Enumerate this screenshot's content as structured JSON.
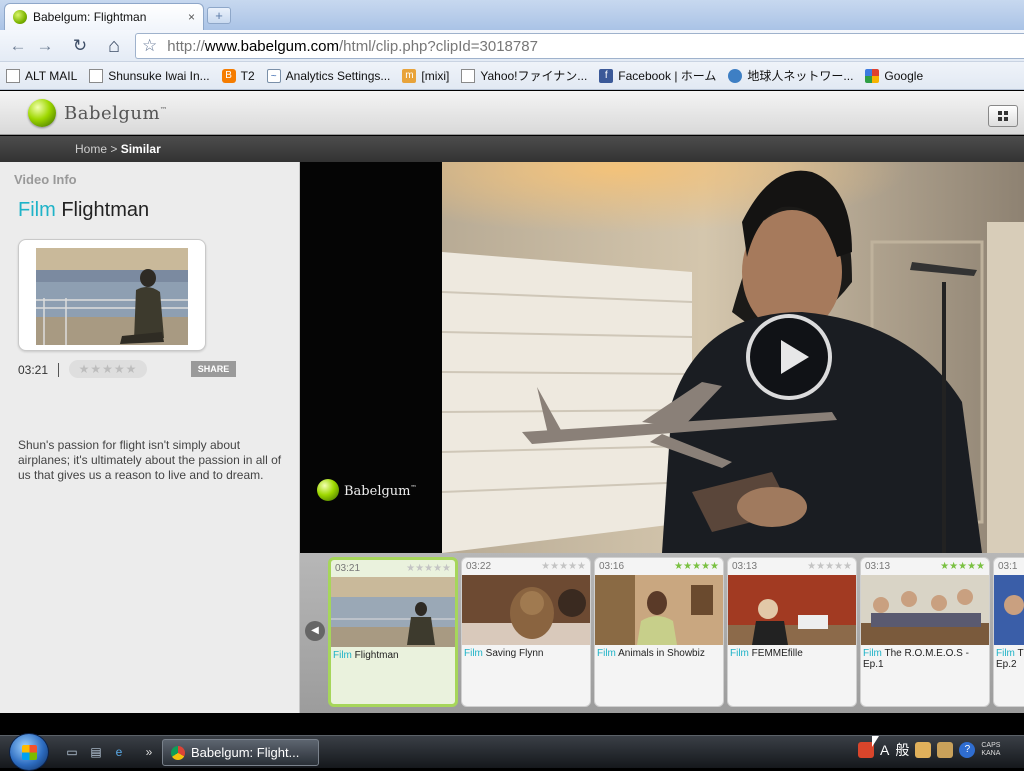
{
  "browser": {
    "tab_title": "Babelgum: Flightman",
    "close_glyph": "×",
    "new_tab_glyph": "+",
    "url_scheme": "http://",
    "url_host": "www.babelgum.com",
    "url_path": "/html/clip.php?clipId=3018787",
    "back_glyph": "←",
    "forward_glyph": "→",
    "reload_glyph": "↻",
    "home_glyph": "⌂",
    "star_glyph": "☆"
  },
  "bookmarks": [
    {
      "label": "ALT MAIL",
      "icon": "page-icon"
    },
    {
      "label": "Shunsuke Iwai In...",
      "icon": "page-icon"
    },
    {
      "label": "T2",
      "icon": "blogger-icon"
    },
    {
      "label": "Analytics Settings...",
      "icon": "analytics-icon"
    },
    {
      "label": "[mixi]",
      "icon": "mixi-icon"
    },
    {
      "label": "Yahoo!ファイナン...",
      "icon": "page-icon"
    },
    {
      "label": "Facebook | ホーム",
      "icon": "facebook-icon"
    },
    {
      "label": "地球人ネットワー...",
      "icon": "earth-icon"
    },
    {
      "label": "Google",
      "icon": "google-icon"
    }
  ],
  "site": {
    "logo_text": "Babelgum",
    "logo_tm": "™",
    "breadcrumb_home": "Home",
    "breadcrumb_sep": ">",
    "breadcrumb_current": "Similar"
  },
  "info": {
    "section_label": "Video Info",
    "category": "Film",
    "title": "Flightman",
    "duration": "03:21",
    "stars": "★★★★★",
    "share_label": "SHARE",
    "description": "Shun's passion for flight isn't simply about airplanes; it's ultimately about the passion in all of us that gives us a reason to live and to dream."
  },
  "player": {
    "logo_text": "Babelgum",
    "logo_tm": "™"
  },
  "related": [
    {
      "duration": "03:21",
      "stars": "★★★★★",
      "rated": false,
      "category": "Film",
      "title": "Flightman",
      "selected": true
    },
    {
      "duration": "03:22",
      "stars": "★★★★★",
      "rated": false,
      "category": "Film",
      "title": "Saving Flynn",
      "selected": false
    },
    {
      "duration": "03:16",
      "stars": "★★★★★",
      "rated": true,
      "category": "Film",
      "title": "Animals in Showbiz",
      "selected": false
    },
    {
      "duration": "03:13",
      "stars": "★★★★★",
      "rated": false,
      "category": "Film",
      "title": "FEMMEfille",
      "selected": false
    },
    {
      "duration": "03:13",
      "stars": "★★★★★",
      "rated": true,
      "category": "Film",
      "title": "The R.O.M.E.O.S - Ep.1",
      "selected": false
    },
    {
      "duration": "03:1",
      "stars": "",
      "rated": false,
      "category": "Film",
      "title": "T Ep.2",
      "selected": false
    }
  ],
  "strip": {
    "prev_glyph": "◀"
  },
  "taskbar": {
    "task_label": "Babelgum: Flight...",
    "overflow_glyph": "»",
    "ime_a": "A",
    "ime_mode": "般",
    "caps": "CAPS",
    "kana": "KANA",
    "help_glyph": "?"
  },
  "colors": {
    "accent_cyan": "#1fb3c8",
    "brand_green": "#9ed800",
    "rated_star_green": "#7ac142",
    "selected_card_border": "#a6d65a"
  }
}
